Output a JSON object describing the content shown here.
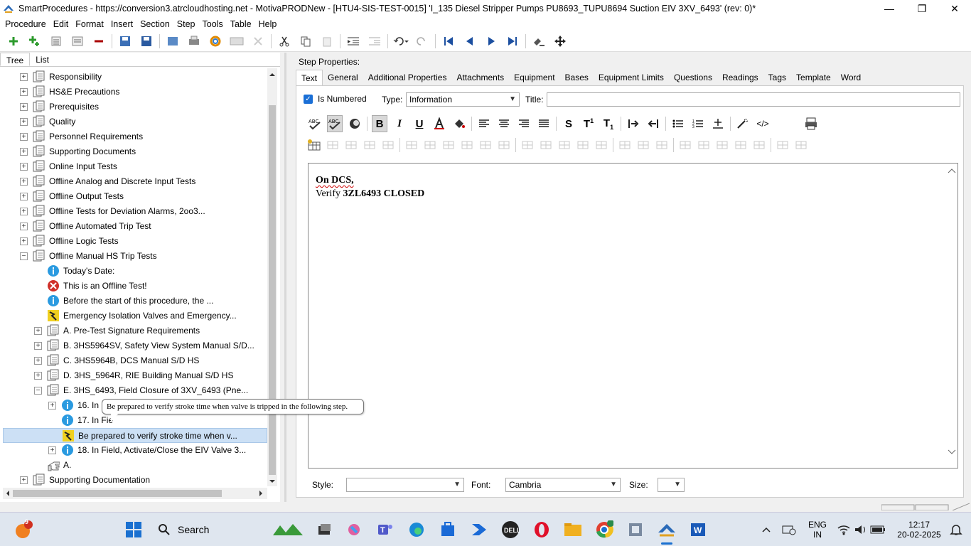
{
  "window": {
    "title": "SmartProcedures - https://conversion3.atrcloudhosting.net - MotivaPRODNew - [HTU4-SIS-TEST-0015] 'I_135 Diesel Stripper Pumps PU8693_TUPU8694 Suction EIV 3XV_6493' (rev: 0)*",
    "minimize": "—",
    "restore": "❐",
    "close": "✕"
  },
  "menu": [
    "Procedure",
    "Edit",
    "Format",
    "Insert",
    "Section",
    "Step",
    "Tools",
    "Table",
    "Help"
  ],
  "left_tabs": [
    "Tree",
    "List"
  ],
  "tree": [
    {
      "label": "Responsibility",
      "level": 0,
      "exp": "+",
      "icon": "doc"
    },
    {
      "label": "HS&E Precautions",
      "level": 0,
      "exp": "+",
      "icon": "doc"
    },
    {
      "label": "Prerequisites",
      "level": 0,
      "exp": "+",
      "icon": "doc"
    },
    {
      "label": "Quality",
      "level": 0,
      "exp": "+",
      "icon": "doc"
    },
    {
      "label": "Personnel Requirements",
      "level": 0,
      "exp": "+",
      "icon": "doc"
    },
    {
      "label": "Supporting Documents",
      "level": 0,
      "exp": "+",
      "icon": "doc"
    },
    {
      "label": "Online Input Tests",
      "level": 0,
      "exp": "+",
      "icon": "doc"
    },
    {
      "label": "Offline Analog and Discrete Input Tests",
      "level": 0,
      "exp": "+",
      "icon": "doc"
    },
    {
      "label": "Offline Output Tests",
      "level": 0,
      "exp": "+",
      "icon": "doc"
    },
    {
      "label": "Offline Tests for Deviation Alarms, 2oo3...",
      "level": 0,
      "exp": "+",
      "icon": "doc"
    },
    {
      "label": "Offline Automated Trip Test",
      "level": 0,
      "exp": "+",
      "icon": "doc"
    },
    {
      "label": "Offline Logic Tests",
      "level": 0,
      "exp": "+",
      "icon": "doc"
    },
    {
      "label": "Offline Manual HS Trip Tests",
      "level": 0,
      "exp": "−",
      "icon": "doc"
    },
    {
      "label": "Today's Date:",
      "level": 1,
      "exp": "",
      "icon": "info"
    },
    {
      "label": "This is an Offline Test!",
      "level": 1,
      "exp": "",
      "icon": "error"
    },
    {
      "label": "Before the start of this procedure, the ...",
      "level": 1,
      "exp": "",
      "icon": "info"
    },
    {
      "label": "Emergency Isolation Valves and Emergency...",
      "level": 1,
      "exp": "",
      "icon": "warn"
    },
    {
      "label": "A. Pre-Test Signature Requirements",
      "level": 1,
      "exp": "+",
      "icon": "doc"
    },
    {
      "label": "B. 3HS5964SV, Safety View System Manual S/D...",
      "level": 1,
      "exp": "+",
      "icon": "doc"
    },
    {
      "label": "C. 3HS5964B, DCS Manual S/D HS",
      "level": 1,
      "exp": "+",
      "icon": "doc"
    },
    {
      "label": "D. 3HS_5964R, RIE Building Manual S/D HS",
      "level": 1,
      "exp": "+",
      "icon": "doc"
    },
    {
      "label": "E. 3HS_6493, Field Closure of 3XV_6493 (Pne...",
      "level": 1,
      "exp": "−",
      "icon": "doc"
    },
    {
      "label": "16. In",
      "level": 2,
      "exp": "+",
      "icon": "info"
    },
    {
      "label": "17. In Fie",
      "level": 2,
      "exp": "",
      "icon": "info"
    },
    {
      "label": "Be prepared to verify stroke time when v...",
      "level": 2,
      "exp": "",
      "icon": "warn",
      "selected": true
    },
    {
      "label": "18. In Field, Activate/Close the EIV Valve 3...",
      "level": 2,
      "exp": "+",
      "icon": "info"
    },
    {
      "label": "A.",
      "level": 1,
      "exp": "",
      "icon": "hand"
    },
    {
      "label": "Supporting Documentation",
      "level": 0,
      "exp": "+",
      "icon": "doc"
    }
  ],
  "tooltip": "Be prepared to verify stroke time when valve is tripped in the following step.",
  "step_properties": {
    "heading": "Step Properties:",
    "tabs": [
      "Text",
      "General",
      "Additional Properties",
      "Attachments",
      "Equipment",
      "Bases",
      "Equipment Limits",
      "Questions",
      "Readings",
      "Tags",
      "Template",
      "Word"
    ],
    "is_numbered_label": "Is Numbered",
    "type_label": "Type:",
    "type_value": "Information",
    "title_label": "Title:",
    "title_value": "",
    "editor_line1": "On DCS,",
    "editor_line2_prefix": "Verify ",
    "editor_line2_bold": "3ZL6493 CLOSED",
    "style_label": "Style:",
    "style_value": "",
    "font_label": "Font:",
    "font_value": "Cambria",
    "size_label": "Size:",
    "size_value": ""
  },
  "taskbar": {
    "notif_count": "9",
    "search": "Search",
    "lang1": "ENG",
    "lang2": "IN",
    "time": "12:17",
    "date": "20-02-2025"
  }
}
